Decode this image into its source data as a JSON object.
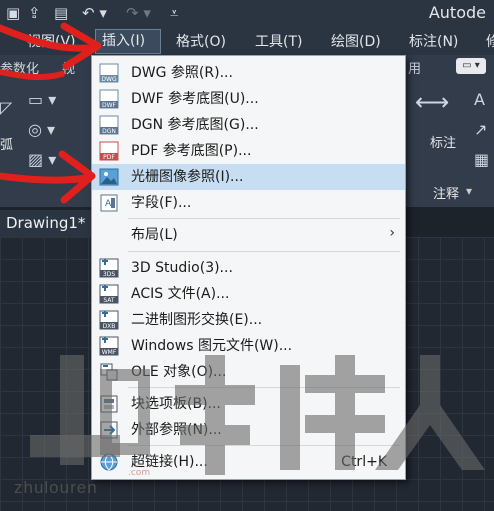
{
  "window": {
    "app_title": "Autode"
  },
  "menubar": {
    "items": [
      {
        "label": "视图(V)"
      },
      {
        "label": "插入(I)"
      },
      {
        "label": "格式(O)"
      },
      {
        "label": "工具(T)"
      },
      {
        "label": "绘图(D)"
      },
      {
        "label": "标注(N)"
      },
      {
        "label": "修"
      }
    ]
  },
  "ribbon": {
    "tab_left": "参数化",
    "tab_view": "视",
    "tab_right": "用",
    "panel_left_label": "弧",
    "annotate_label": "标注",
    "annotate_panel": "注释"
  },
  "doc_tabs": {
    "drawing": "Drawing1*"
  },
  "dropdown": {
    "items": [
      {
        "label": "DWG 参照(R)...",
        "icon": "dwg-icon",
        "icon_text": "DWG"
      },
      {
        "label": "DWF 参考底图(U)...",
        "icon": "dwf-icon",
        "icon_text": "DWF"
      },
      {
        "label": "DGN 参考底图(G)...",
        "icon": "dgn-icon",
        "icon_text": "DGN"
      },
      {
        "label": "PDF 参考底图(P)...",
        "icon": "pdf-icon",
        "icon_text": "PDF"
      },
      {
        "label": "光栅图像参照(I)...",
        "icon": "raster-image-icon",
        "highlighted": true
      },
      {
        "label": "字段(F)...",
        "icon": "field-icon"
      },
      {
        "label": "布局(L)",
        "icon": "",
        "submenu": true
      },
      {
        "label": "3D Studio(3)...",
        "icon": "3ds-icon",
        "icon_text": "3DS"
      },
      {
        "label": "ACIS 文件(A)...",
        "icon": "acis-icon",
        "icon_text": "SAT"
      },
      {
        "label": "二进制图形交换(E)...",
        "icon": "dxb-icon",
        "icon_text": "DXB"
      },
      {
        "label": "Windows 图元文件(W)...",
        "icon": "wmf-icon",
        "icon_text": "WMF"
      },
      {
        "label": "OLE 对象(O)...",
        "icon": "ole-icon"
      },
      {
        "label": "块选项板(B)...",
        "icon": "block-palette-icon"
      },
      {
        "label": "外部参照(N)...",
        "icon": "xref-icon"
      },
      {
        "label": "超链接(H)...",
        "icon": "hyperlink-icon",
        "shortcut": "Ctrl+K"
      }
    ]
  },
  "watermark": {
    "text": "zhulouren",
    "sub": ".com"
  },
  "colors": {
    "highlight": "#c7def2",
    "annotation_arrow": "#e0201c",
    "menu_bg": "#f5f6f7"
  }
}
